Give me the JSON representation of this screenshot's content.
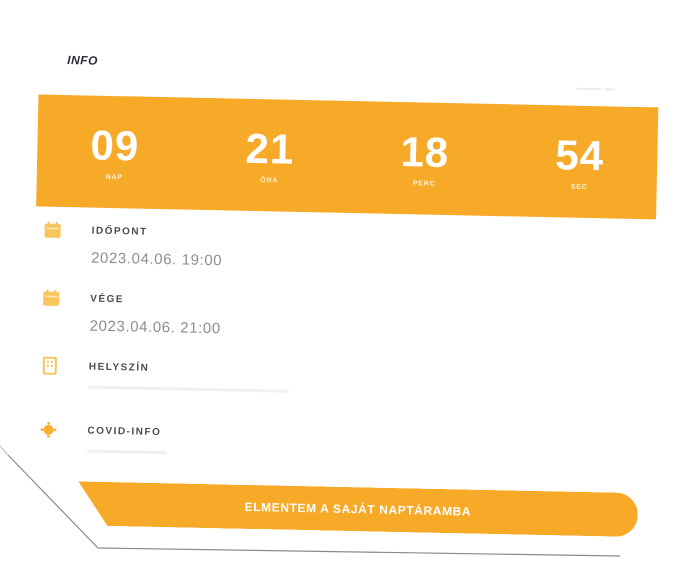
{
  "section": {
    "title": "INFO"
  },
  "countdown": [
    {
      "value": "09",
      "label": "NAP"
    },
    {
      "value": "21",
      "label": "ÓRA"
    },
    {
      "value": "18",
      "label": "PERC"
    },
    {
      "value": "54",
      "label": "SEC"
    }
  ],
  "details": {
    "start": {
      "label": "IDŐPONT",
      "value": "2023.04.06. 19:00"
    },
    "end": {
      "label": "VÉGE",
      "value": "2023.04.06. 21:00"
    },
    "venue": {
      "label": "HELYSZÍN"
    },
    "covid": {
      "label": "COVID-INFO"
    }
  },
  "actions": {
    "save_label": "ELMENTEM A SAJÁT NAPTÁRAMBA"
  },
  "colors": {
    "accent": "#f7a928",
    "icon": "#f7c55a",
    "text": "#4a4a55"
  }
}
